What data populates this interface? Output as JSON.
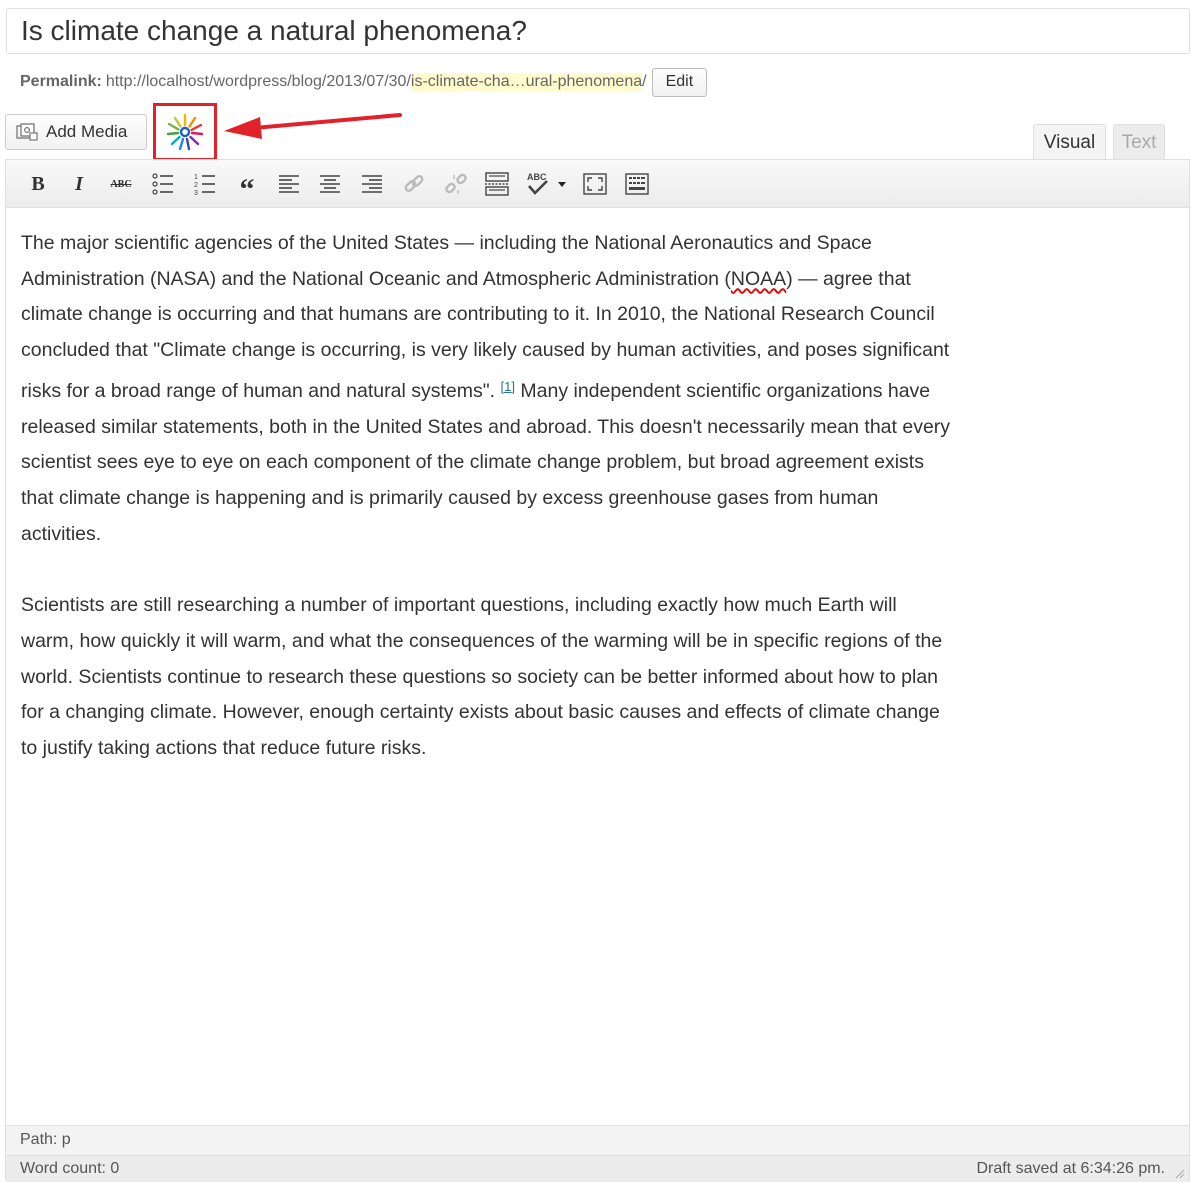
{
  "post": {
    "title": "Is climate change a natural phenomena?"
  },
  "permalink": {
    "label": "Permalink:",
    "base": "http://localhost/wordpress/blog/2013/07/30/",
    "slug": "is-climate-cha…ural-phenomena",
    "trailing": "/",
    "edit_label": "Edit"
  },
  "media": {
    "add_media_label": "Add Media"
  },
  "tabs": {
    "visual": "Visual",
    "text": "Text"
  },
  "toolbar": {
    "buttons": [
      "bold-icon",
      "italic-icon",
      "strikethrough-icon",
      "bullet-list-icon",
      "numbered-list-icon",
      "blockquote-icon",
      "align-left-icon",
      "align-center-icon",
      "align-right-icon",
      "link-icon",
      "unlink-icon",
      "read-more-icon",
      "spellcheck-icon",
      "fullscreen-icon",
      "kitchen-sink-icon"
    ],
    "bold": "B",
    "italic": "I",
    "strike": "ABC",
    "quote": "“",
    "spell": "ABC"
  },
  "content": {
    "p1_a": "The major scientific agencies of the United States — including the National Aeronautics and Space Administration (NASA) and the National Oceanic and Atmospheric Administration (",
    "p1_noaa": "NOAA",
    "p1_b": ") — agree that climate change is occurring and that humans are contributing to it. In 2010, the National Research Council concluded that \"Climate change is occurring, is very likely caused by human activities, and poses significant risks for a broad range of human and natural systems\". ",
    "p1_ref": "[1]",
    "p1_c": " Many independent scientific organizations have released similar statements, both in the United States and abroad. This doesn't necessarily mean that every scientist sees eye to eye on each component of the climate change problem, but broad agreement exists that climate change is happening and is primarily caused by excess greenhouse gases from human activities.",
    "p2": "Scientists are still researching a number of important questions, including exactly how much Earth will warm, how quickly it will warm, and what the consequences of the warming will be in specific regions of the world. Scientists continue to research these questions so society can be better informed about how to plan for a changing climate. However, enough certainty exists about basic causes and effects of climate change to justify taking actions that reduce future risks."
  },
  "footer": {
    "path": "Path: p",
    "word_count": "Word count: 0",
    "draft_saved": "Draft saved at 6:34:26 pm."
  },
  "colors": {
    "highlight_border": "#e0222a",
    "arrow": "#e0222a",
    "slug_bg": "#fffbcc",
    "link": "#21759b"
  }
}
